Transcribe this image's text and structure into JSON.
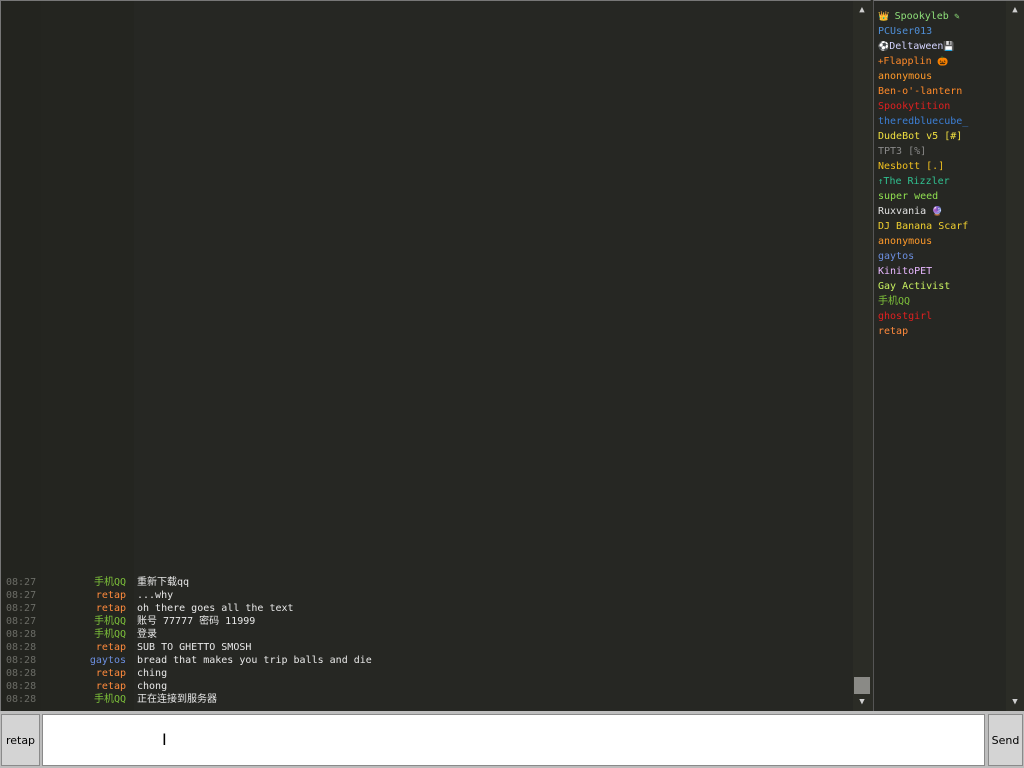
{
  "messages": [
    {
      "time": "08:27",
      "name": "手机QQ",
      "name_color": "#7ec23a",
      "text": "重新下载qq"
    },
    {
      "time": "08:27",
      "name": "retap",
      "name_color": "#ff8a3c",
      "text": "...why"
    },
    {
      "time": "08:27",
      "name": "retap",
      "name_color": "#ff8a3c",
      "text": "oh there goes all the text"
    },
    {
      "time": "08:27",
      "name": "手机QQ",
      "name_color": "#7ec23a",
      "text": "账号 77777 密码 11999"
    },
    {
      "time": "08:28",
      "name": "手机QQ",
      "name_color": "#7ec23a",
      "text": "登录"
    },
    {
      "time": "08:28",
      "name": "retap",
      "name_color": "#ff8a3c",
      "text": "SUB TO GHETTO SMOSH"
    },
    {
      "time": "08:28",
      "name": "gaytos",
      "name_color": "#6c8fe0",
      "text": "bread that makes you trip balls and die"
    },
    {
      "time": "08:28",
      "name": "retap",
      "name_color": "#ff8a3c",
      "text": "ching"
    },
    {
      "time": "08:28",
      "name": "retap",
      "name_color": "#ff8a3c",
      "text": "chong"
    },
    {
      "time": "08:28",
      "name": "手机QQ",
      "name_color": "#7ec23a",
      "text": "正在连接到服务器"
    }
  ],
  "users": [
    {
      "prefix": "👑 ",
      "name": "Spookyleb",
      "suffix": " ✎",
      "color": "#8fe07a"
    },
    {
      "prefix": "",
      "name": "PCUser013",
      "suffix": "",
      "color": "#4f8fd8"
    },
    {
      "prefix": "⚽",
      "name": "Deltaween",
      "suffix": "💾",
      "color": "#d4d4ff"
    },
    {
      "prefix": "+",
      "name": "Flapplin",
      "suffix": " 🎃",
      "color": "#ff8a2a"
    },
    {
      "prefix": "",
      "name": "anonymous",
      "suffix": "",
      "color": "#ff9a2a"
    },
    {
      "prefix": "",
      "name": "Ben-o'-lantern",
      "suffix": "",
      "color": "#ff8a2a"
    },
    {
      "prefix": "",
      "name": "Spookytition",
      "suffix": "",
      "color": "#e02020"
    },
    {
      "prefix": "",
      "name": "theredbluecube_",
      "suffix": "",
      "color": "#3c7fd6"
    },
    {
      "prefix": "",
      "name": "DudeBot v5 [#]",
      "suffix": "",
      "color": "#f0e040"
    },
    {
      "prefix": "",
      "name": "TPT3 [%]",
      "suffix": "",
      "color": "#8a8a8a"
    },
    {
      "prefix": "",
      "name": "Nesbott [.]",
      "suffix": "",
      "color": "#f0c020"
    },
    {
      "prefix": "↑",
      "name": "The Rizzler",
      "suffix": "",
      "color": "#30c090"
    },
    {
      "prefix": "",
      "name": "super weed",
      "suffix": "",
      "color": "#90e050"
    },
    {
      "prefix": "",
      "name": "Ruxvania",
      "suffix": " 🔮",
      "color": "#e0e0e0"
    },
    {
      "prefix": "",
      "name": "DJ Banana Scarf",
      "suffix": "",
      "color": "#f0d030"
    },
    {
      "prefix": "",
      "name": "anonymous",
      "suffix": "",
      "color": "#ff9a2a"
    },
    {
      "prefix": "",
      "name": "gaytos",
      "suffix": "",
      "color": "#6c8fe0"
    },
    {
      "prefix": "",
      "name": "KinitoPET",
      "suffix": "",
      "color": "#e8b8ff"
    },
    {
      "prefix": "",
      "name": "Gay Activist",
      "suffix": "",
      "color": "#c8f060"
    },
    {
      "prefix": "",
      "name": "手机QQ",
      "suffix": "",
      "color": "#7ec23a"
    },
    {
      "prefix": "",
      "name": "ghostgirl",
      "suffix": "",
      "color": "#e02020"
    },
    {
      "prefix": "",
      "name": "retap",
      "suffix": "",
      "color": "#ff8a3c"
    }
  ],
  "input": {
    "name_button": "retap",
    "send_button": "Send",
    "value": ""
  },
  "scroll_up_icon": "up-arrow",
  "scroll_down_icon": "down-arrow"
}
